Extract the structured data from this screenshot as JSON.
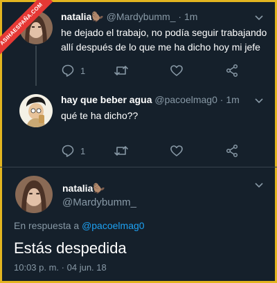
{
  "watermark": "ASIHAESPAÑA.COM",
  "tweets": [
    {
      "name": "natalia",
      "emoji": "🦫",
      "handle": "@Mardybumm_",
      "dot": "·",
      "time": "1m",
      "text_line1": "he dejado el trabajo, no podía seguir trabajando",
      "text_line2": "allí después de lo que me ha dicho hoy mi jefe",
      "reply_count": "1"
    },
    {
      "name": "hay que beber agua",
      "handle": "@pacoelmag0",
      "dot": "·",
      "time": "1m",
      "text_line1": "qué te ha dicho??",
      "reply_count": "1"
    }
  ],
  "main_tweet": {
    "name": "natalia",
    "emoji": "🦫",
    "handle": "@Mardybumm_",
    "reply_prefix": "En respuesta a",
    "reply_mention": "@pacoelmag0",
    "text": "Estás despedida",
    "time": "10:03 p. m.",
    "dot": "·",
    "date": "04 jun. 18"
  },
  "colors": {
    "background": "#15202b",
    "frame": "#e3b520",
    "muted": "#8899a6",
    "link": "#1da1f2",
    "watermark": "#e53935"
  },
  "icons": [
    "reply-icon",
    "retweet-icon",
    "like-icon",
    "share-icon",
    "chevron-down-icon"
  ]
}
